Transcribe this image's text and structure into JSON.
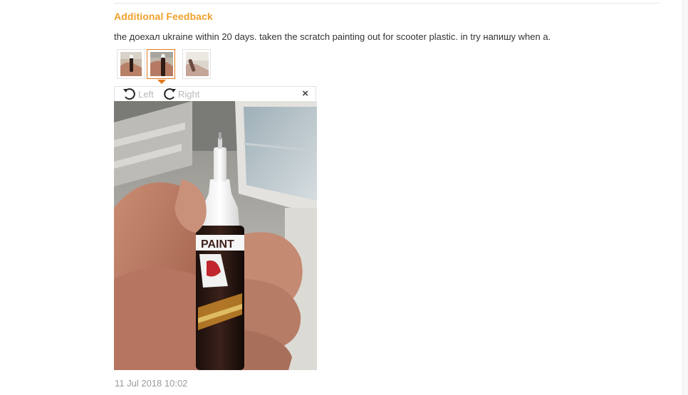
{
  "feedback": {
    "title": "Additional Feedback",
    "text": "the доехал ukraine within 20 days. taken the scratch painting out for scooter plastic. in try напишу when a.",
    "date": "11 Jul 2018 10:02"
  },
  "viewer": {
    "rotate_left_label": "Left",
    "rotate_right_label": "Right",
    "close_glyph": "×",
    "photo_label_text": "PAINT"
  },
  "thumbnails": [
    {
      "name": "thumb-1",
      "selected": false
    },
    {
      "name": "thumb-2",
      "selected": true
    },
    {
      "name": "thumb-3",
      "selected": false
    }
  ],
  "colors": {
    "accent": "#f0a12a",
    "selected_border": "#e2791f"
  }
}
